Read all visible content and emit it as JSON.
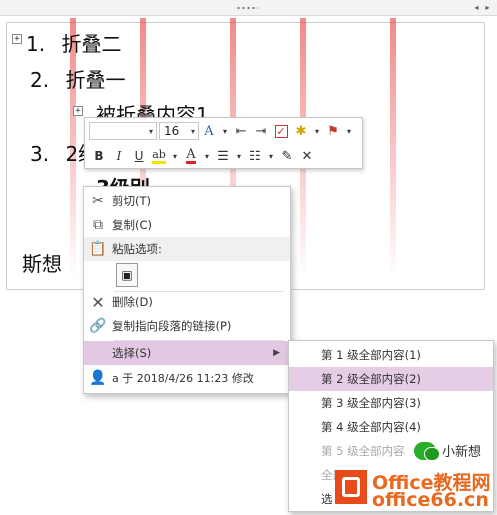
{
  "document": {
    "outline": [
      {
        "number": "1.",
        "text": "折叠二"
      },
      {
        "number": "2.",
        "text": "折叠一"
      },
      {
        "sub": "被折叠内容1"
      },
      {
        "number": "3.",
        "text": "2级"
      },
      {
        "sub": "3级别"
      },
      {
        "text": "斯想"
      }
    ]
  },
  "mini_toolbar": {
    "font_name": "",
    "font_size": "16",
    "bold": "B",
    "italic": "I",
    "underline": "U",
    "font_color_letter": "A"
  },
  "context_menu": {
    "items": [
      {
        "label": "剪切(T)",
        "icon": "scissors-icon"
      },
      {
        "label": "复制(C)",
        "icon": "copy-icon"
      },
      {
        "label": "粘贴选项:",
        "icon": "clipboard-icon"
      },
      {
        "label": "删除(D)",
        "icon": "delete-x-icon"
      },
      {
        "label": "复制指向段落的链接(P)",
        "icon": "link-icon"
      },
      {
        "label": "选择(S)",
        "icon": "select-icon"
      },
      {
        "label": "a 于 2018/4/26 11:23 修改",
        "icon": "user-icon"
      }
    ]
  },
  "submenu": {
    "items": [
      {
        "label": "第 1 级全部内容(1)",
        "enabled": true
      },
      {
        "label": "第 2 级全部内容(2)",
        "enabled": true
      },
      {
        "label": "第 3 级全部内容(3)",
        "enabled": true
      },
      {
        "label": "第 4 级全部内容(4)",
        "enabled": true
      },
      {
        "label": "第 5 级全部内容",
        "enabled": false
      },
      {
        "label": "全部",
        "enabled": false
      },
      {
        "label": "选",
        "enabled": true
      }
    ]
  },
  "branding": {
    "chat_name": "小新想",
    "site": "Office教程网",
    "url": "www.office26.com",
    "url_short": "office66.cn"
  },
  "colors": {
    "accent_purple": "#e2c8e2",
    "brand_orange": "#e8691f",
    "logo_red": "#e94a1a",
    "font_color_red": "#d22"
  }
}
